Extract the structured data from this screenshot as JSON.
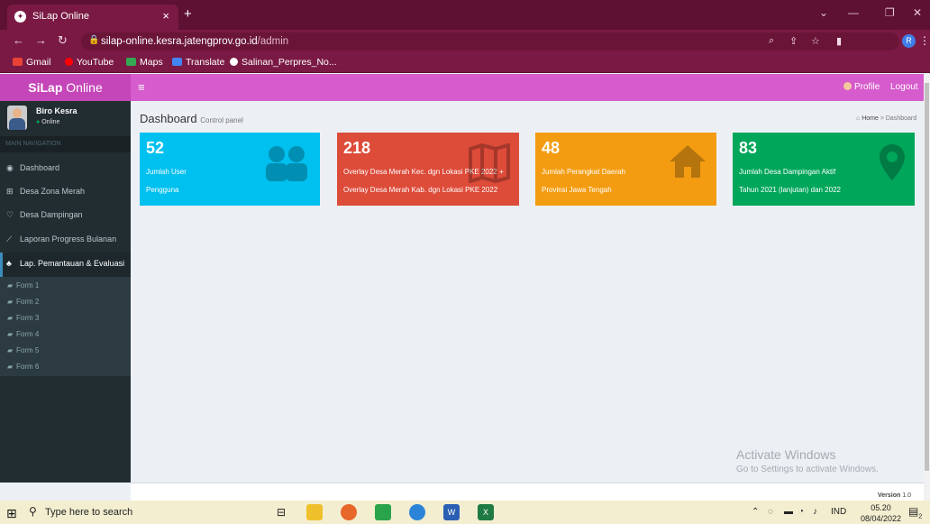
{
  "browser": {
    "tab_title": "SiLap Online",
    "tab_close": "×",
    "new_tab": "+",
    "url_host": "silap-online.kesra.jatengprov.go.id",
    "url_path": "/admin",
    "profile_letter": "R",
    "bookmarks": [
      "Gmail",
      "YouTube",
      "Maps",
      "Translate",
      "Salinan_Perpres_No..."
    ]
  },
  "app": {
    "logo_bold": "SiLap",
    "logo_rest": " Online",
    "profile_label": "Profile",
    "logout_label": "Logout"
  },
  "sidebar": {
    "user_name": "Biro Kesra",
    "user_status": "Online",
    "nav_header": "MAIN NAVIGATION",
    "items": [
      {
        "label": "Dashboard",
        "icon": "dashboard-icon"
      },
      {
        "label": "Desa Zona Merah",
        "icon": "plus-square-icon"
      },
      {
        "label": "Desa Dampingan",
        "icon": "heart-icon"
      },
      {
        "label": "Laporan Progress Bulanan",
        "icon": "line-chart-icon"
      },
      {
        "label": "Lap. Pemantauan & Evaluasi",
        "icon": "sitemap-icon"
      }
    ],
    "subitems": [
      "Form 1",
      "Form 2",
      "Form 3",
      "Form 4",
      "Form 5",
      "Form 6"
    ]
  },
  "page": {
    "title": "Dashboard",
    "subtitle": "Control panel",
    "breadcrumb_home": "Home",
    "breadcrumb_sep": ">",
    "breadcrumb_current": "Dashboard"
  },
  "boxes": [
    {
      "number": "52",
      "line1": "Jumlah User",
      "line2": "Pengguna",
      "color": "#00c0ef",
      "icon": "users-icon"
    },
    {
      "number": "218",
      "line1": "Overlay Desa Merah Kec. dgn Lokasi PKE 2022 +",
      "line2": "Overlay Desa Merah Kab. dgn Lokasi PKE 2022",
      "color": "#dd4b39",
      "icon": "map-icon"
    },
    {
      "number": "48",
      "line1": "Jumlah Perangkat Daerah",
      "line2": "Provinsi Jawa Tengah",
      "color": "#f39c12",
      "icon": "home-icon"
    },
    {
      "number": "83",
      "line1": "Jumlah Desa Dampingan Aktif",
      "line2": "Tahun 2021 (lanjutan) dan 2022",
      "color": "#00a65a",
      "icon": "map-marker-icon"
    }
  ],
  "watermark": {
    "line1": "Activate Windows",
    "line2": "Go to Settings to activate Windows."
  },
  "footer": {
    "version_label": "Version",
    "version_value": "1.0"
  },
  "taskbar": {
    "search_placeholder": "Type here to search",
    "language": "IND",
    "time": "05.20",
    "date": "08/04/2022",
    "notification_count": "2"
  }
}
